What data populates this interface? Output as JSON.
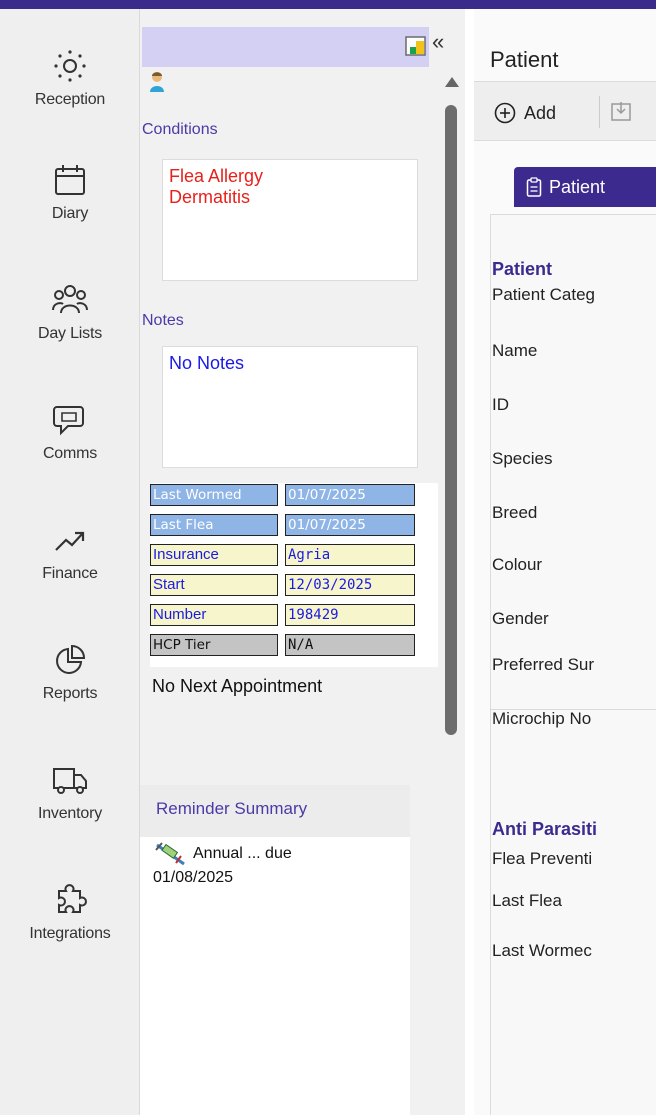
{
  "nav": {
    "items": [
      {
        "label": "Reception",
        "icon": "reception-icon"
      },
      {
        "label": "Diary",
        "icon": "calendar-icon"
      },
      {
        "label": "Day Lists",
        "icon": "people-icon"
      },
      {
        "label": "Comms",
        "icon": "chat-icon"
      },
      {
        "label": "Finance",
        "icon": "trend-icon"
      },
      {
        "label": "Reports",
        "icon": "pie-chart-icon"
      },
      {
        "label": "Inventory",
        "icon": "truck-icon"
      },
      {
        "label": "Integrations",
        "icon": "puzzle-icon"
      }
    ]
  },
  "side": {
    "collapse_glyph": "«",
    "conditions_label": "Conditions",
    "conditions_lines": [
      "Flea Allergy",
      "Dermatitis"
    ],
    "notes_label": "Notes",
    "notes_text": "No Notes",
    "info": [
      {
        "k": "Last Wormed",
        "v": "01/07/2025",
        "style": "blue"
      },
      {
        "k": "Last Flea",
        "v": "01/07/2025",
        "style": "blue"
      },
      {
        "k": "Insurance",
        "v": "Agria",
        "style": "yellow"
      },
      {
        "k": "Start",
        "v": "12/03/2025",
        "style": "yellow"
      },
      {
        "k": "Number",
        "v": "198429",
        "style": "yellow"
      },
      {
        "k": "HCP Tier",
        "v": "N/A",
        "style": "grey"
      }
    ],
    "next_appointment": "No Next Appointment",
    "reminder_summary_label": "Reminder Summary",
    "reminder_line1": "Annual ... due",
    "reminder_line2": "01/08/2025"
  },
  "main": {
    "title": "Patient",
    "add_label": "Add",
    "tab_label": "Patient",
    "section_patient": "Patient",
    "fields": [
      "Patient Categ",
      "Name",
      "ID",
      "Species",
      "Breed",
      "Colour",
      "Gender",
      "Preferred Sur",
      "Microchip No"
    ],
    "section_anti": "Anti Parasiti",
    "anti_fields": [
      "Flea Preventi",
      "Last Flea",
      "Last Wormec"
    ]
  },
  "colors": {
    "brand": "#3d2a8f",
    "condition_text": "#e8211b",
    "notes_text": "#1a1ae6",
    "header_band": "#d4d0f3"
  }
}
